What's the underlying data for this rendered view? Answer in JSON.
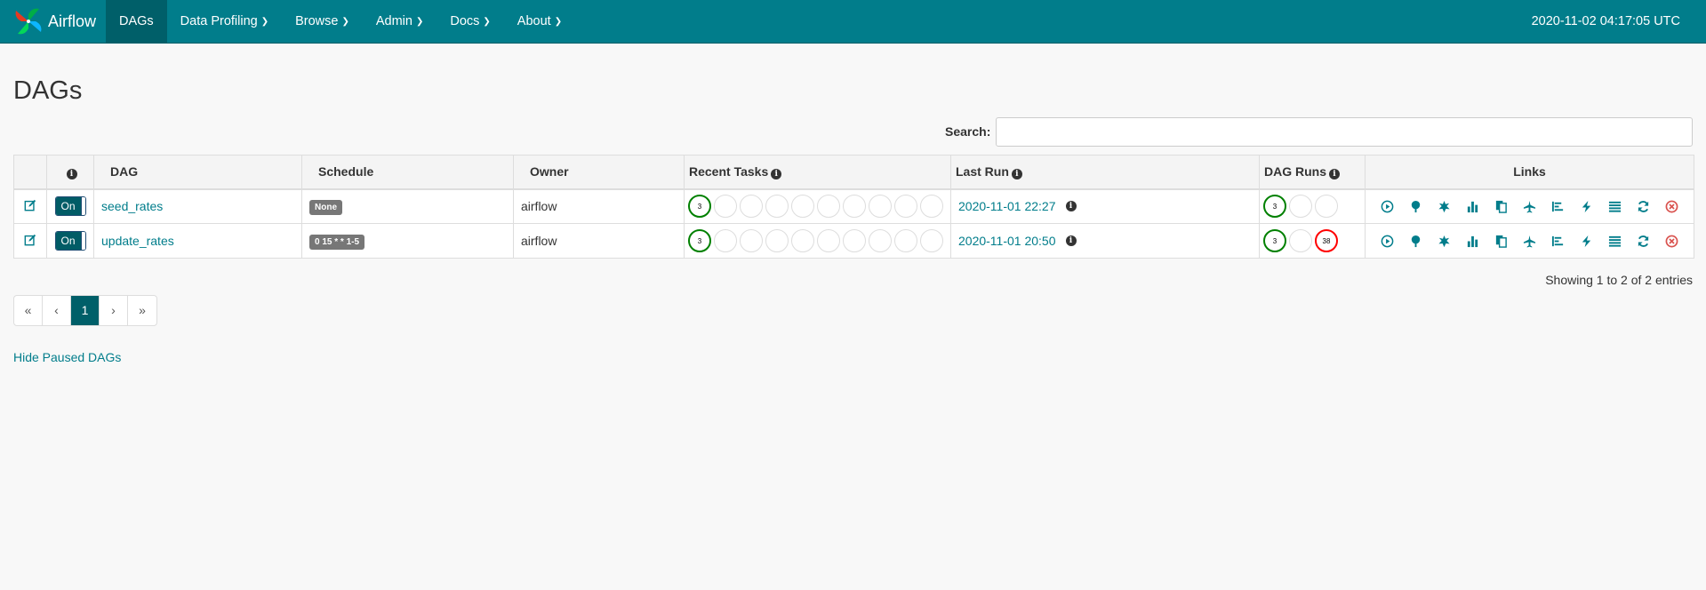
{
  "brand": {
    "name": "Airflow"
  },
  "nav": {
    "items": [
      {
        "label": "DAGs",
        "active": true,
        "dropdown": false
      },
      {
        "label": "Data Profiling",
        "dropdown": true
      },
      {
        "label": "Browse",
        "dropdown": true
      },
      {
        "label": "Admin",
        "dropdown": true
      },
      {
        "label": "Docs",
        "dropdown": true
      },
      {
        "label": "About",
        "dropdown": true
      }
    ],
    "time": "2020-11-02 04:17:05 UTC"
  },
  "page": {
    "title": "DAGs"
  },
  "search": {
    "label": "Search:",
    "value": ""
  },
  "table": {
    "headers": {
      "info": "i",
      "dag": "DAG",
      "schedule": "Schedule",
      "owner": "Owner",
      "recent_tasks": "Recent Tasks",
      "last_run": "Last Run",
      "dag_runs": "DAG Runs",
      "links": "Links"
    },
    "rows": [
      {
        "toggle": "On",
        "dag_id": "seed_rates",
        "schedule": "None",
        "owner": "airflow",
        "recent_tasks": [
          "3",
          "",
          "",
          "",
          "",
          "",
          "",
          "",
          "",
          ""
        ],
        "last_run": "2020-11-01 22:27",
        "dag_runs": [
          "3",
          "",
          ""
        ]
      },
      {
        "toggle": "On",
        "dag_id": "update_rates",
        "schedule": "0 15 * * 1-5",
        "owner": "airflow",
        "recent_tasks": [
          "3",
          "",
          "",
          "",
          "",
          "",
          "",
          "",
          "",
          ""
        ],
        "last_run": "2020-11-01 20:50",
        "dag_runs": [
          "3",
          "",
          "38"
        ]
      }
    ]
  },
  "colors": {
    "primary": "#017d8b",
    "success": "#008000",
    "failed": "#ff0000"
  },
  "footer": {
    "showing": "Showing 1 to 2 of 2 entries",
    "pagination": [
      "«",
      "‹",
      "1",
      "›",
      "»"
    ],
    "hide_paused": "Hide Paused DAGs"
  }
}
